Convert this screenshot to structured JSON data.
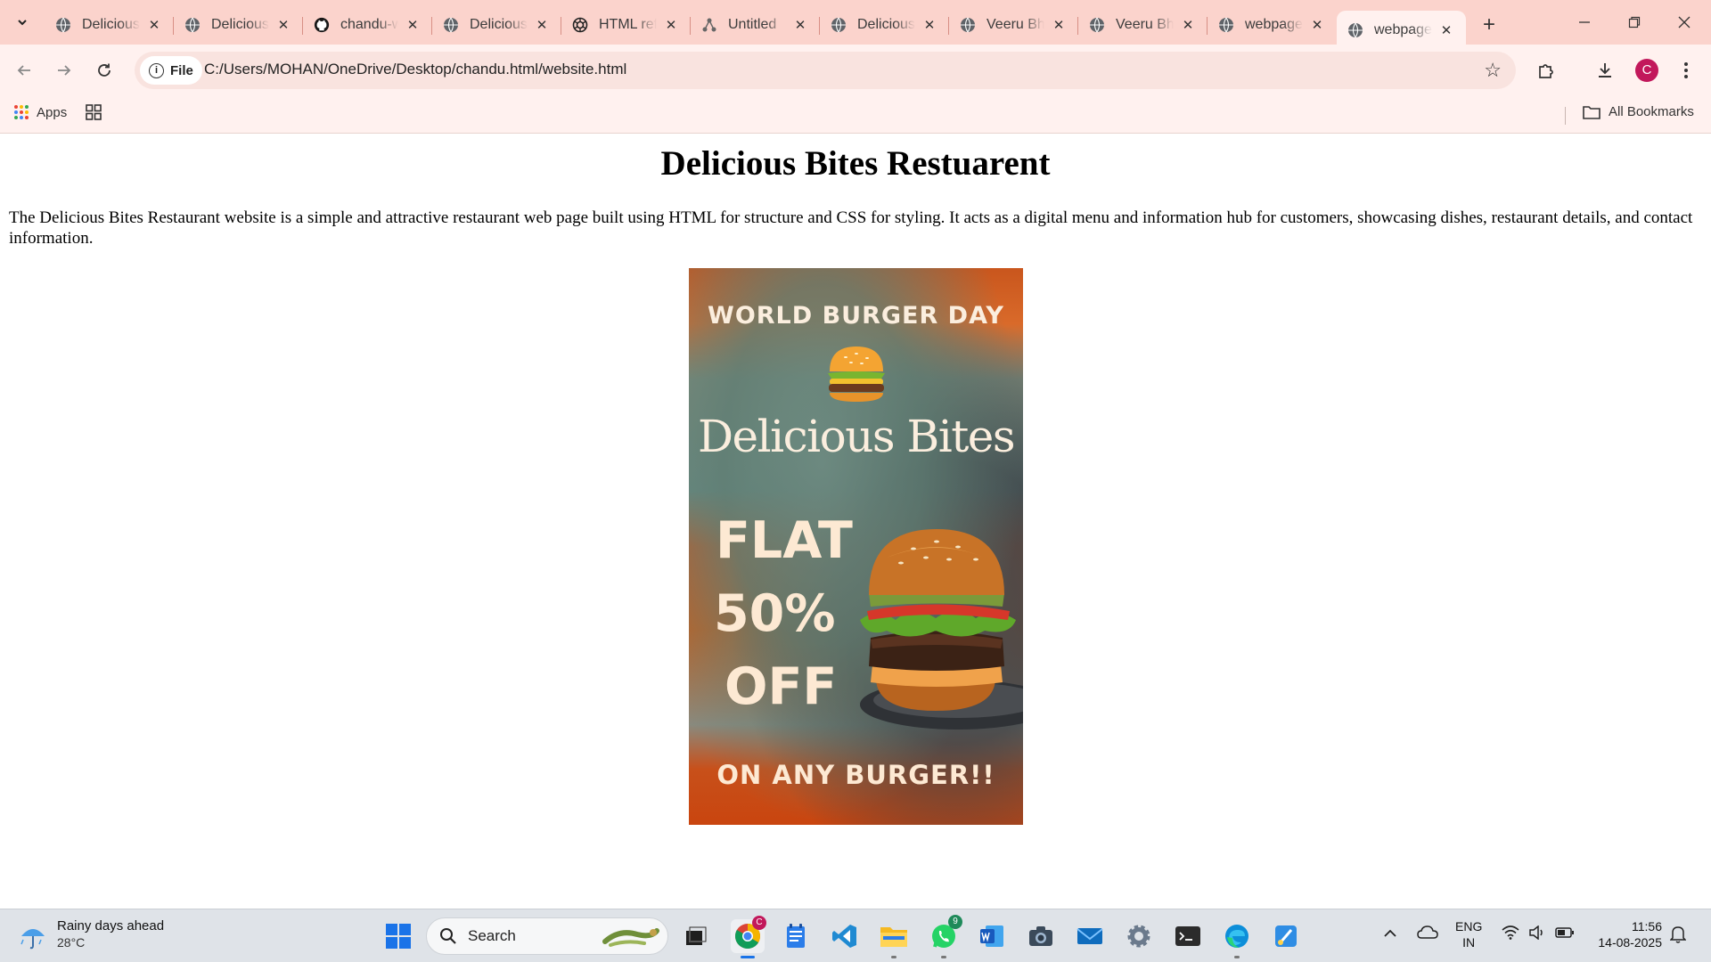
{
  "browser": {
    "tabs": [
      {
        "title": "Delicious Bites Restuarent",
        "icon": "globe-icon",
        "active": false
      },
      {
        "title": "Delicious Bites Restuarent",
        "icon": "globe-icon",
        "active": false
      },
      {
        "title": "chandu-website",
        "icon": "github-icon",
        "active": false
      },
      {
        "title": "Delicious Bites Restuarent",
        "icon": "globe-icon",
        "active": false
      },
      {
        "title": "HTML reference",
        "icon": "openai-icon",
        "active": false
      },
      {
        "title": "Untitled",
        "icon": "diagram-icon",
        "active": false
      },
      {
        "title": "Delicious Bites Restuarent",
        "icon": "globe-icon",
        "active": false
      },
      {
        "title": "Veeru Bhai",
        "icon": "globe-icon",
        "active": false
      },
      {
        "title": "Veeru Bhai",
        "icon": "globe-icon",
        "active": false
      },
      {
        "title": "webpage",
        "icon": "globe-icon",
        "active": false
      },
      {
        "title": "webpage",
        "icon": "globe-icon",
        "active": true
      }
    ],
    "new_tab_label": "+",
    "address": {
      "scheme_chip": "File",
      "url": "C:/Users/MOHAN/OneDrive/Desktop/chandu.html/website.html"
    },
    "profile_initial": "C",
    "bookmarks": {
      "apps_label": "Apps",
      "all_bookmarks_label": "All Bookmarks"
    },
    "accent_color": "#fbd3cc"
  },
  "page": {
    "heading": "Delicious Bites Restuarent",
    "description": "The Delicious Bites Restaurant website is a simple and attractive restaurant web page built using HTML for structure and CSS for styling. It acts as a digital menu and information hub for customers, showcasing dishes, restaurant details, and contact information.",
    "poster": {
      "top_text": "WORLD BURGER DAY",
      "brand": "Delicious Bites",
      "offer_lines": [
        "FLAT",
        "50%",
        "OFF"
      ],
      "bottom_text": "ON ANY BURGER!!"
    }
  },
  "taskbar": {
    "weather": {
      "headline": "Rainy days ahead",
      "temp": "28°C"
    },
    "search_placeholder": "Search",
    "apps": [
      "start",
      "search",
      "task-view",
      "chrome",
      "notepad",
      "vscode",
      "file-explorer",
      "whatsapp",
      "word",
      "camera",
      "mail",
      "settings",
      "terminal",
      "edge",
      "paint"
    ],
    "whatsapp_badge": "9",
    "chrome_badge": "C",
    "language": {
      "line1": "ENG",
      "line2": "IN"
    },
    "time": "11:56",
    "date": "14-08-2025"
  }
}
